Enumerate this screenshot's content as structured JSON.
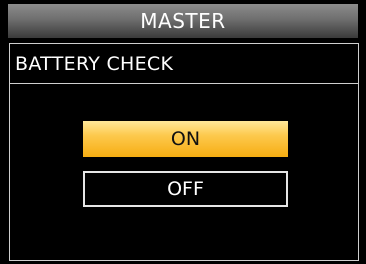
{
  "header": {
    "title": "MASTER"
  },
  "panel": {
    "title": "BATTERY CHECK",
    "options": [
      {
        "label": "ON",
        "selected": true
      },
      {
        "label": "OFF",
        "selected": false
      }
    ]
  },
  "colors": {
    "background": "#000000",
    "selected_option": "#f9b82a",
    "border": "#cfcfcf",
    "text": "#ffffff"
  }
}
